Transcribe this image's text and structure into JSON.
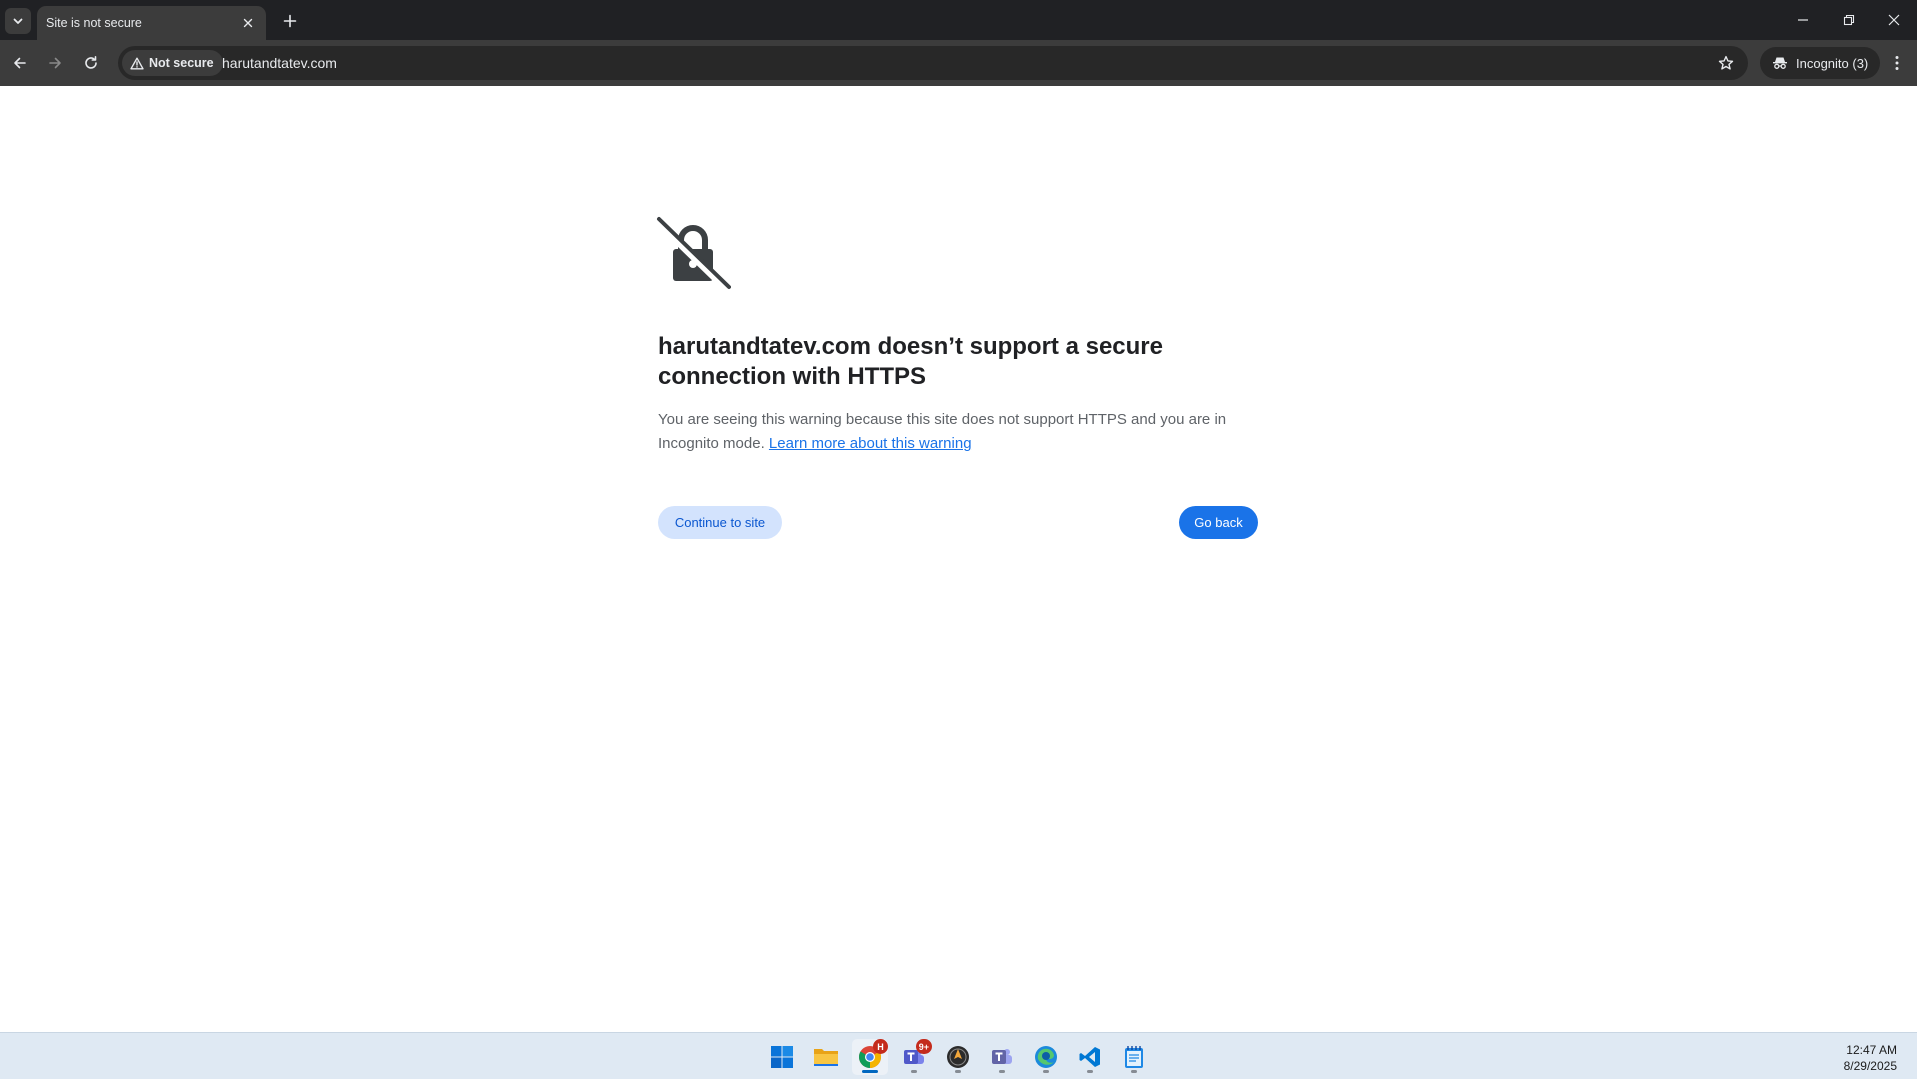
{
  "browser": {
    "tab_title": "Site is not secure",
    "security_chip": "Not secure",
    "url": "harutandtatev.com",
    "incognito_label": "Incognito (3)",
    "tab_search_icon": "chevron-down-icon",
    "new_tab_icon": "plus-icon"
  },
  "page": {
    "heading": "harutandtatev.com doesn’t support a secure connection with HTTPS",
    "description": "You are seeing this warning because this site does not support HTTPS and you are in Incognito mode.",
    "learn_more_link": "Learn more about this warning",
    "continue_button": "Continue to site",
    "go_back_button": "Go back",
    "icon": "lock-slash-icon"
  },
  "taskbar": {
    "apps": [
      {
        "name": "start",
        "icon": "windows-start-icon"
      },
      {
        "name": "file-explorer",
        "icon": "folder-icon"
      },
      {
        "name": "chrome",
        "icon": "chrome-icon",
        "badge": "H",
        "active": true
      },
      {
        "name": "teams-classic",
        "icon": "teams-icon",
        "badge": "9+"
      },
      {
        "name": "app-dark-circle",
        "icon": "compass-icon"
      },
      {
        "name": "teams",
        "icon": "teams-icon"
      },
      {
        "name": "edge",
        "icon": "edge-icon"
      },
      {
        "name": "vscode",
        "icon": "vscode-icon"
      },
      {
        "name": "notepad",
        "icon": "notepad-icon"
      }
    ],
    "time": "12:47 AM",
    "date": "8/29/2025"
  },
  "colors": {
    "tabstrip": "#202124",
    "toolbar": "#3c3c3c",
    "primary_button": "#1a73e8",
    "secondary_button": "#d3e3fd",
    "taskbar": "#dfe9f3"
  }
}
